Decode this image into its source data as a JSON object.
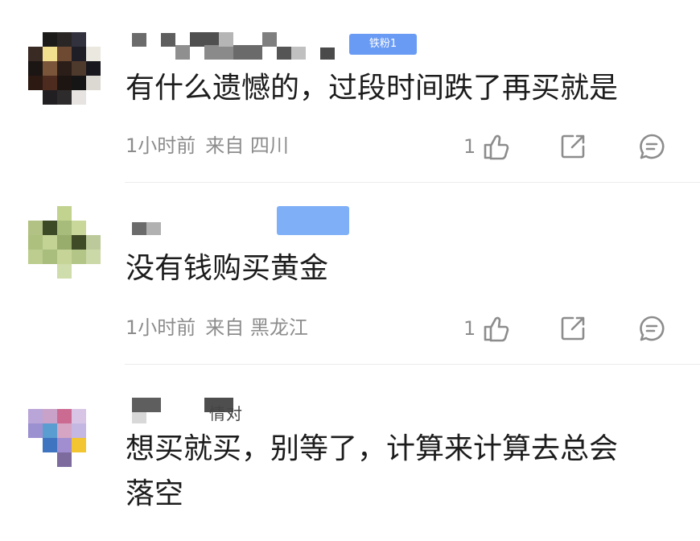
{
  "comments": [
    {
      "name_hint": "",
      "badge": "铁粉1",
      "badge_color": "#6a9bf4",
      "text": "有什么遗憾的，过段时间跌了再买就是",
      "time": "1小时前",
      "location": "来自 四川",
      "likes": "1"
    },
    {
      "name_hint": "",
      "badge": "",
      "badge_color": "#7fb0f7",
      "text": "没有钱购买黄金",
      "time": "1小时前",
      "location": "来自 黑龙江",
      "likes": "1"
    },
    {
      "name_hint": "情对",
      "badge": "",
      "badge_color": "",
      "text_line1": "想买就买，别等了，计算来计算去总会",
      "text_line2": "落空"
    }
  ],
  "icons": {
    "like": "thumbs-up-icon",
    "share": "share-icon",
    "reply": "comment-icon"
  }
}
